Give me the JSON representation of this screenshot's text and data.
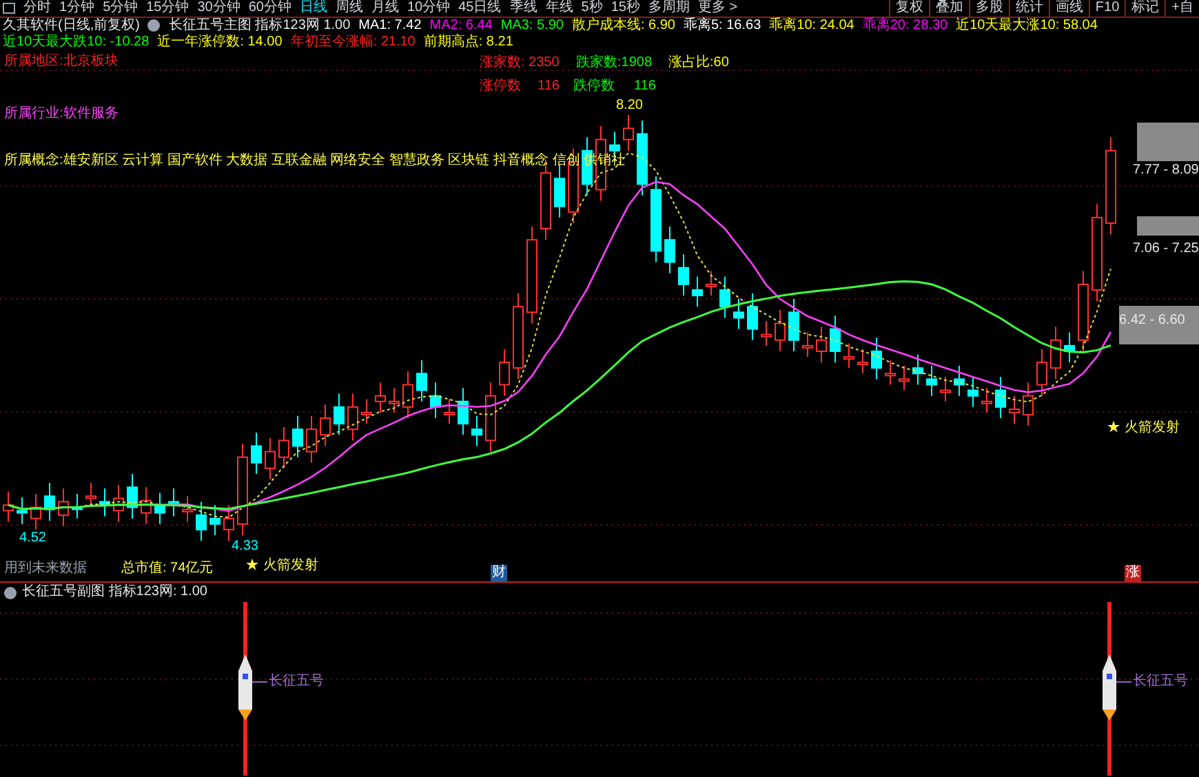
{
  "toolbar": {
    "tabs": [
      {
        "label": "分时",
        "selected": false
      },
      {
        "label": "1分钟",
        "selected": false
      },
      {
        "label": "5分钟",
        "selected": false
      },
      {
        "label": "15分钟",
        "selected": false
      },
      {
        "label": "30分钟",
        "selected": false
      },
      {
        "label": "60分钟",
        "selected": false
      },
      {
        "label": "日线",
        "selected": true
      },
      {
        "label": "周线",
        "selected": false
      },
      {
        "label": "月线",
        "selected": false
      },
      {
        "label": "10分钟",
        "selected": false
      },
      {
        "label": "45日线",
        "selected": false
      },
      {
        "label": "季线",
        "selected": false
      },
      {
        "label": "年线",
        "selected": false
      },
      {
        "label": "5秒",
        "selected": false
      },
      {
        "label": "15秒",
        "selected": false
      },
      {
        "label": "多周期",
        "selected": false
      },
      {
        "label": "更多 >",
        "selected": false
      }
    ],
    "buttons": [
      "复权",
      "叠加",
      "多股",
      "统计",
      "画线",
      "F10",
      "标记",
      "+自"
    ]
  },
  "info_line": {
    "title": "久其软件(日线,前复权)",
    "indicator": "长征五号主图 指标123网 1.00",
    "values": [
      {
        "label": "MA1: 7.42",
        "color": "#ffffff"
      },
      {
        "label": "MA2: 6.44",
        "color": "#ff00ff"
      },
      {
        "label": "MA3: 5.90",
        "color": "#00ff00"
      },
      {
        "label": "散户成本线: 6.90",
        "color": "#ffff00"
      },
      {
        "label": "乖离5: 16.63",
        "color": "#ffffff"
      },
      {
        "label": "乖离10: 24.04",
        "color": "#ffff00"
      },
      {
        "label": "乖离20: 28.30",
        "color": "#ff00ff"
      },
      {
        "label": "近10天最大涨10: 58.04",
        "color": "#ffff00"
      },
      {
        "label": "近10天最大跌10: -10.28",
        "color": "#00ff00"
      },
      {
        "label": "近一年涨停数: 14.00",
        "color": "#ffff00"
      },
      {
        "label": "年初至今涨幅: 21.10",
        "color": "#ff2020"
      },
      {
        "label": "前期高点: 8.21",
        "color": "#ffff00"
      }
    ]
  },
  "chart": {
    "region": "所属地区:北京板块",
    "industry": "所属行业:软件服务",
    "concepts": "所属概念:雄安新区 云计算 国产软件 大数据 互联金融 网络安全 智慧政务 区块链 抖音概念 信创 供销社",
    "stats": [
      {
        "label": "涨家数: 2350",
        "color": "#ff2020"
      },
      {
        "label": "跌家数:1908",
        "color": "#00ff00"
      },
      {
        "label": "涨占比:60",
        "color": "#ffff00"
      },
      {
        "label": "涨停数",
        "color": "#ff2020"
      },
      {
        "label": "116",
        "color": "#ff2020"
      },
      {
        "label": "跌停数",
        "color": "#00ff00"
      },
      {
        "label": "116",
        "color": "#00ff00"
      }
    ],
    "price_labels": [
      {
        "label": "8.20",
        "color": "#ffff00"
      },
      {
        "label": "4.52",
        "color": "#00ffff"
      },
      {
        "label": "4.33",
        "color": "#00ffff"
      }
    ],
    "signals": [
      "★ 火箭发射",
      "★ 火箭发射"
    ],
    "target_zones": [
      "7.77 - 8.09",
      "7.06 - 7.25",
      "6.42 - 6.60"
    ],
    "market_cap": "总市值: 74亿元",
    "future_note": "用到未来数据",
    "event_markers": [
      {
        "label": "财",
        "color": "#1e5a9e"
      },
      {
        "label": "涨",
        "color": "#c02020"
      }
    ]
  },
  "sub_chart": {
    "title": "长征五号副图 指标123网: 1.00",
    "rockets": [
      "长征五号",
      "长征五号"
    ]
  }
}
